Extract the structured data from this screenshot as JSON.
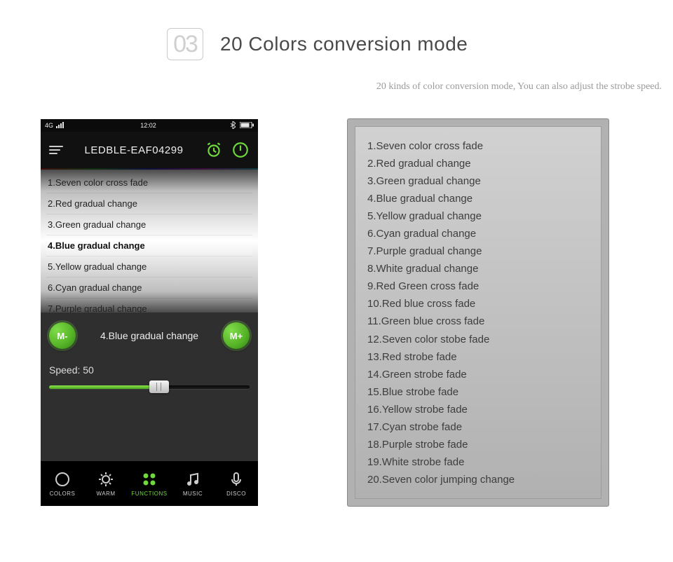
{
  "header": {
    "badge": "03",
    "title": "20 Colors conversion mode",
    "subtitle": "20 kinds of color conversion mode, You can also adjust the strobe speed."
  },
  "phone": {
    "status": {
      "carrier": "4G",
      "time": "12:02"
    },
    "device_name": "LEDBLE-EAF04299",
    "picker": [
      "1.Seven color cross fade",
      "2.Red gradual change",
      "3.Green gradual change",
      "4.Blue gradual change",
      "5.Yellow gradual change",
      "6.Cyan gradual change",
      "7.Purple gradual change"
    ],
    "selected_mode": "4.Blue gradual change",
    "m_minus": "M-",
    "m_plus": "M+",
    "speed_label": "Speed: 50",
    "tabs": {
      "colors": "COLORS",
      "warm": "WARM",
      "functions": "FUNCTIONS",
      "music": "MUSIC",
      "disco": "DISCO"
    }
  },
  "modes": [
    "1.Seven color cross fade",
    "2.Red gradual change",
    "3.Green gradual change",
    "4.Blue gradual change",
    "5.Yellow gradual change",
    "6.Cyan gradual change",
    "7.Purple gradual change",
    "8.White gradual change",
    "9.Red Green cross fade",
    "10.Red blue cross fade",
    "11.Green blue cross fade",
    "12.Seven color stobe fade",
    "13.Red strobe fade",
    "14.Green strobe fade",
    "15.Blue strobe fade",
    "16.Yellow strobe fade",
    "17.Cyan strobe fade",
    "18.Purple strobe fade",
    "19.White strobe fade",
    "20.Seven color jumping change"
  ]
}
